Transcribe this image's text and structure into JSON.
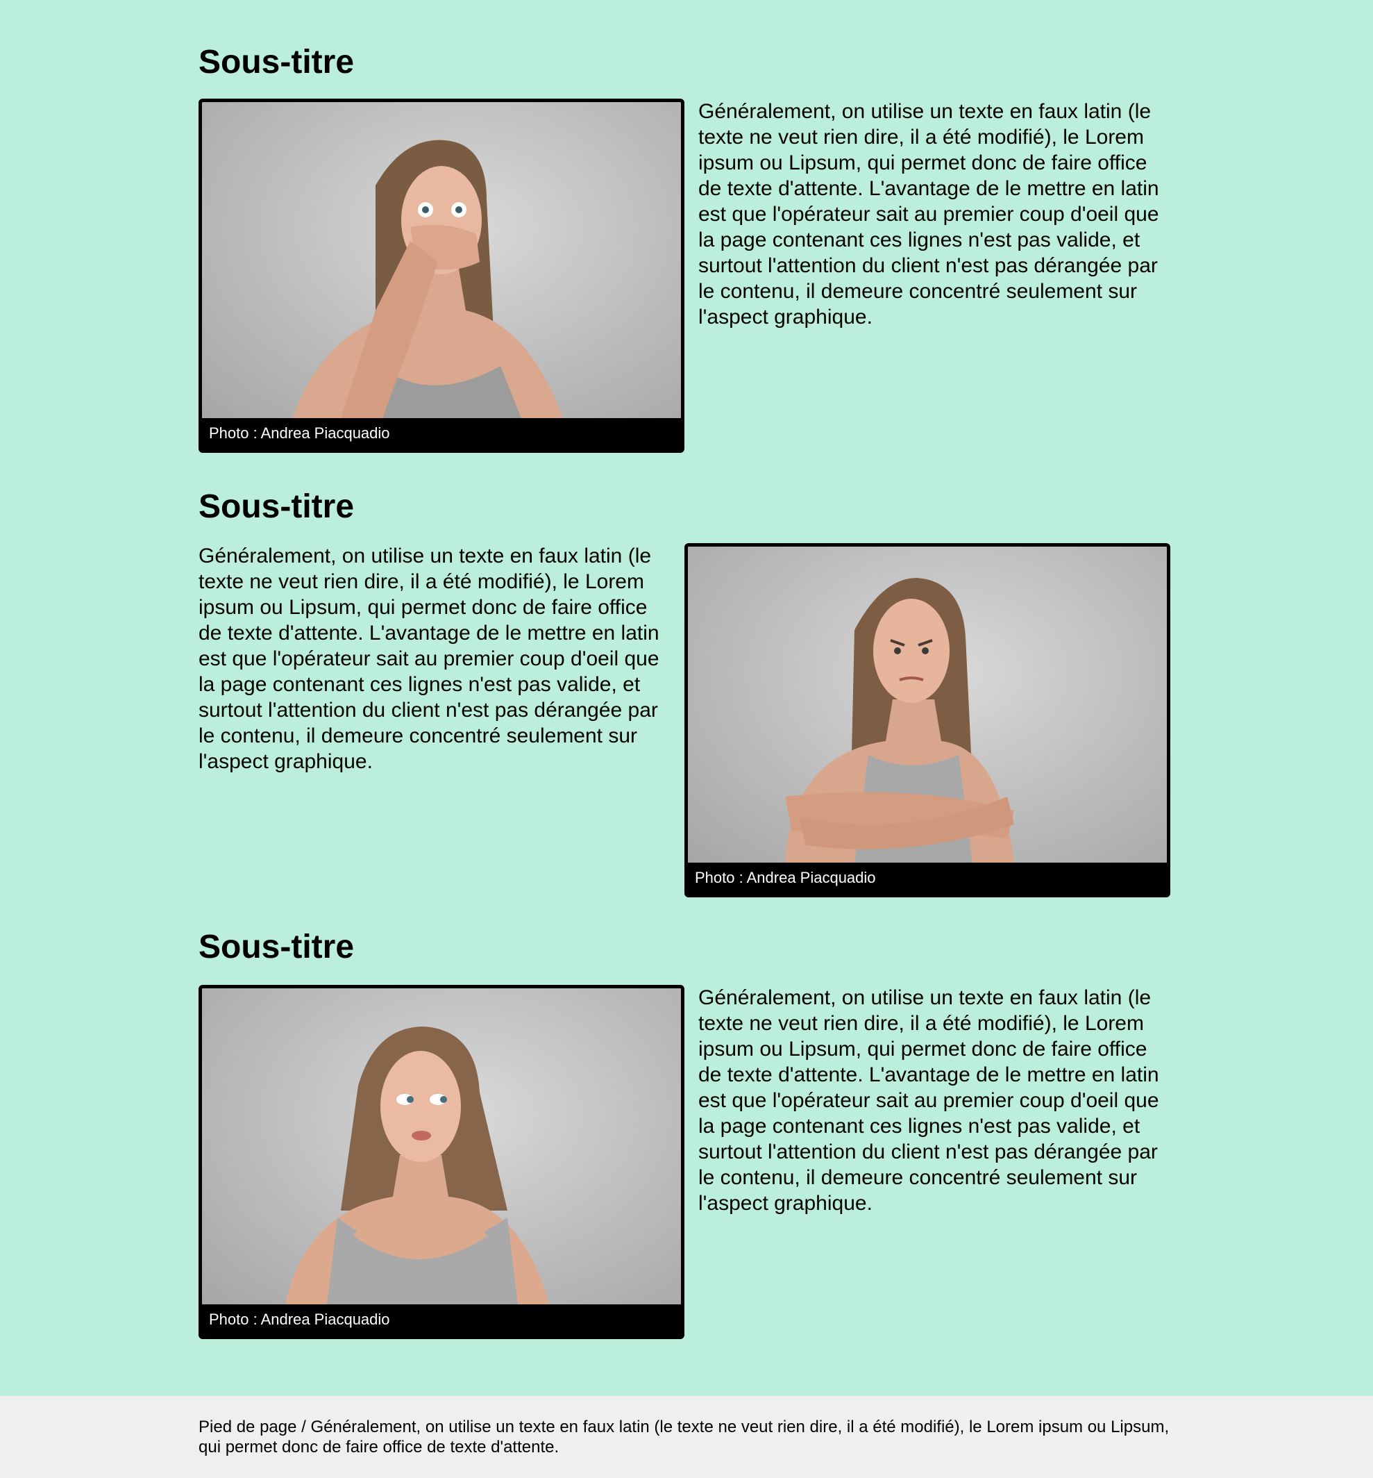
{
  "page": {
    "background_color": "#bbefdc",
    "footer_background_color": "#efefef"
  },
  "sections": [
    {
      "heading": "Sous-titre",
      "image_alt": "woman-covering-mouth",
      "caption": "Photo : Andrea Piacquadio",
      "text": "Généralement, on utilise un texte en faux latin (le texte ne veut rien dire, il a été modifié), le Lorem ipsum ou Lipsum, qui permet donc de faire office de texte d'attente. L'avantage de le mettre en latin est que l'opérateur sait au premier coup d'oeil que la page contenant ces lignes n'est pas valide, et surtout l'attention du client n'est pas dérangée par le contenu, il demeure concentré seulement sur l'aspect graphique."
    },
    {
      "heading": "Sous-titre",
      "image_alt": "woman-arms-crossed",
      "caption": "Photo : Andrea Piacquadio",
      "text": "Généralement, on utilise un texte en faux latin (le texte ne veut rien dire, il a été modifié), le Lorem ipsum ou Lipsum, qui permet donc de faire office de texte d'attente. L'avantage de le mettre en latin est que l'opérateur sait au premier coup d'oeil que la page contenant ces lignes n'est pas valide, et surtout l'attention du client n'est pas dérangée par le contenu, il demeure concentré seulement sur l'aspect graphique."
    },
    {
      "heading": "Sous-titre",
      "image_alt": "woman-looking-sideways",
      "caption": "Photo : Andrea Piacquadio",
      "text": "Généralement, on utilise un texte en faux latin (le texte ne veut rien dire, il a été modifié), le Lorem ipsum ou Lipsum, qui permet donc de faire office de texte d'attente. L'avantage de le mettre en latin est que l'opérateur sait au premier coup d'oeil que la page contenant ces lignes n'est pas valide, et surtout l'attention du client n'est pas dérangée par le contenu, il demeure concentré seulement sur l'aspect graphique."
    }
  ],
  "footer": {
    "text": "Pied de page / Généralement, on utilise un texte en faux latin (le texte ne veut rien dire, il a été modifié), le Lorem ipsum ou Lipsum, qui permet donc de faire office de texte d'attente."
  }
}
